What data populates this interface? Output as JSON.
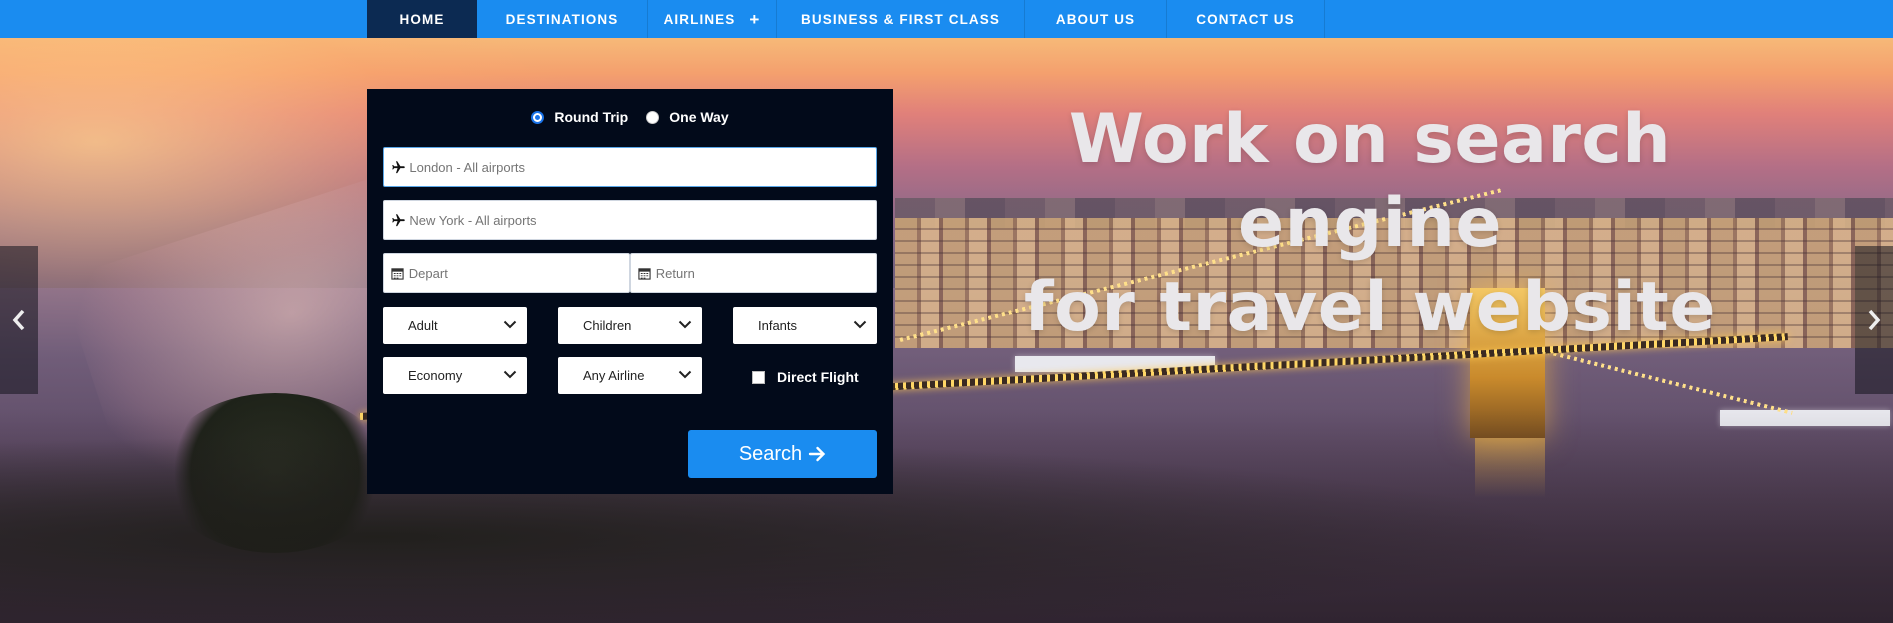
{
  "nav": {
    "items": [
      {
        "label": "HOME",
        "active": true
      },
      {
        "label": "DESTINATIONS"
      },
      {
        "label": "AIRLINES",
        "has_submenu": true
      },
      {
        "label": "BUSINESS & FIRST CLASS"
      },
      {
        "label": "ABOUT US"
      },
      {
        "label": "CONTACT US"
      }
    ],
    "submenu_symbol": "+",
    "bg_color": "#1a8cf0",
    "active_color": "#0c2a52"
  },
  "hero": {
    "title_line1": "Work on search engine",
    "title_line2": "for travel website",
    "prev_arrow": "‹",
    "next_arrow": "›"
  },
  "search": {
    "trip_types": [
      {
        "label": "Round Trip",
        "checked": true
      },
      {
        "label": "One Way",
        "checked": false
      }
    ],
    "from_placeholder": "London - All airports",
    "to_placeholder": "New York - All airports",
    "depart_placeholder": "Depart",
    "return_placeholder": "Return",
    "adult_label": "Adult",
    "children_label": "Children",
    "infants_label": "Infants",
    "class_label": "Economy",
    "airline_label": "Any Airline",
    "direct_flight_label": "Direct Flight",
    "direct_flight_checked": false,
    "search_button_label": "Search",
    "icons": {
      "plane": "airplane-icon",
      "calendar": "calendar-icon",
      "arrow": "arrow-right-icon",
      "chevron": "chevron-down-icon"
    },
    "panel_color": "#020a1a",
    "button_color": "#1a8cf0"
  }
}
